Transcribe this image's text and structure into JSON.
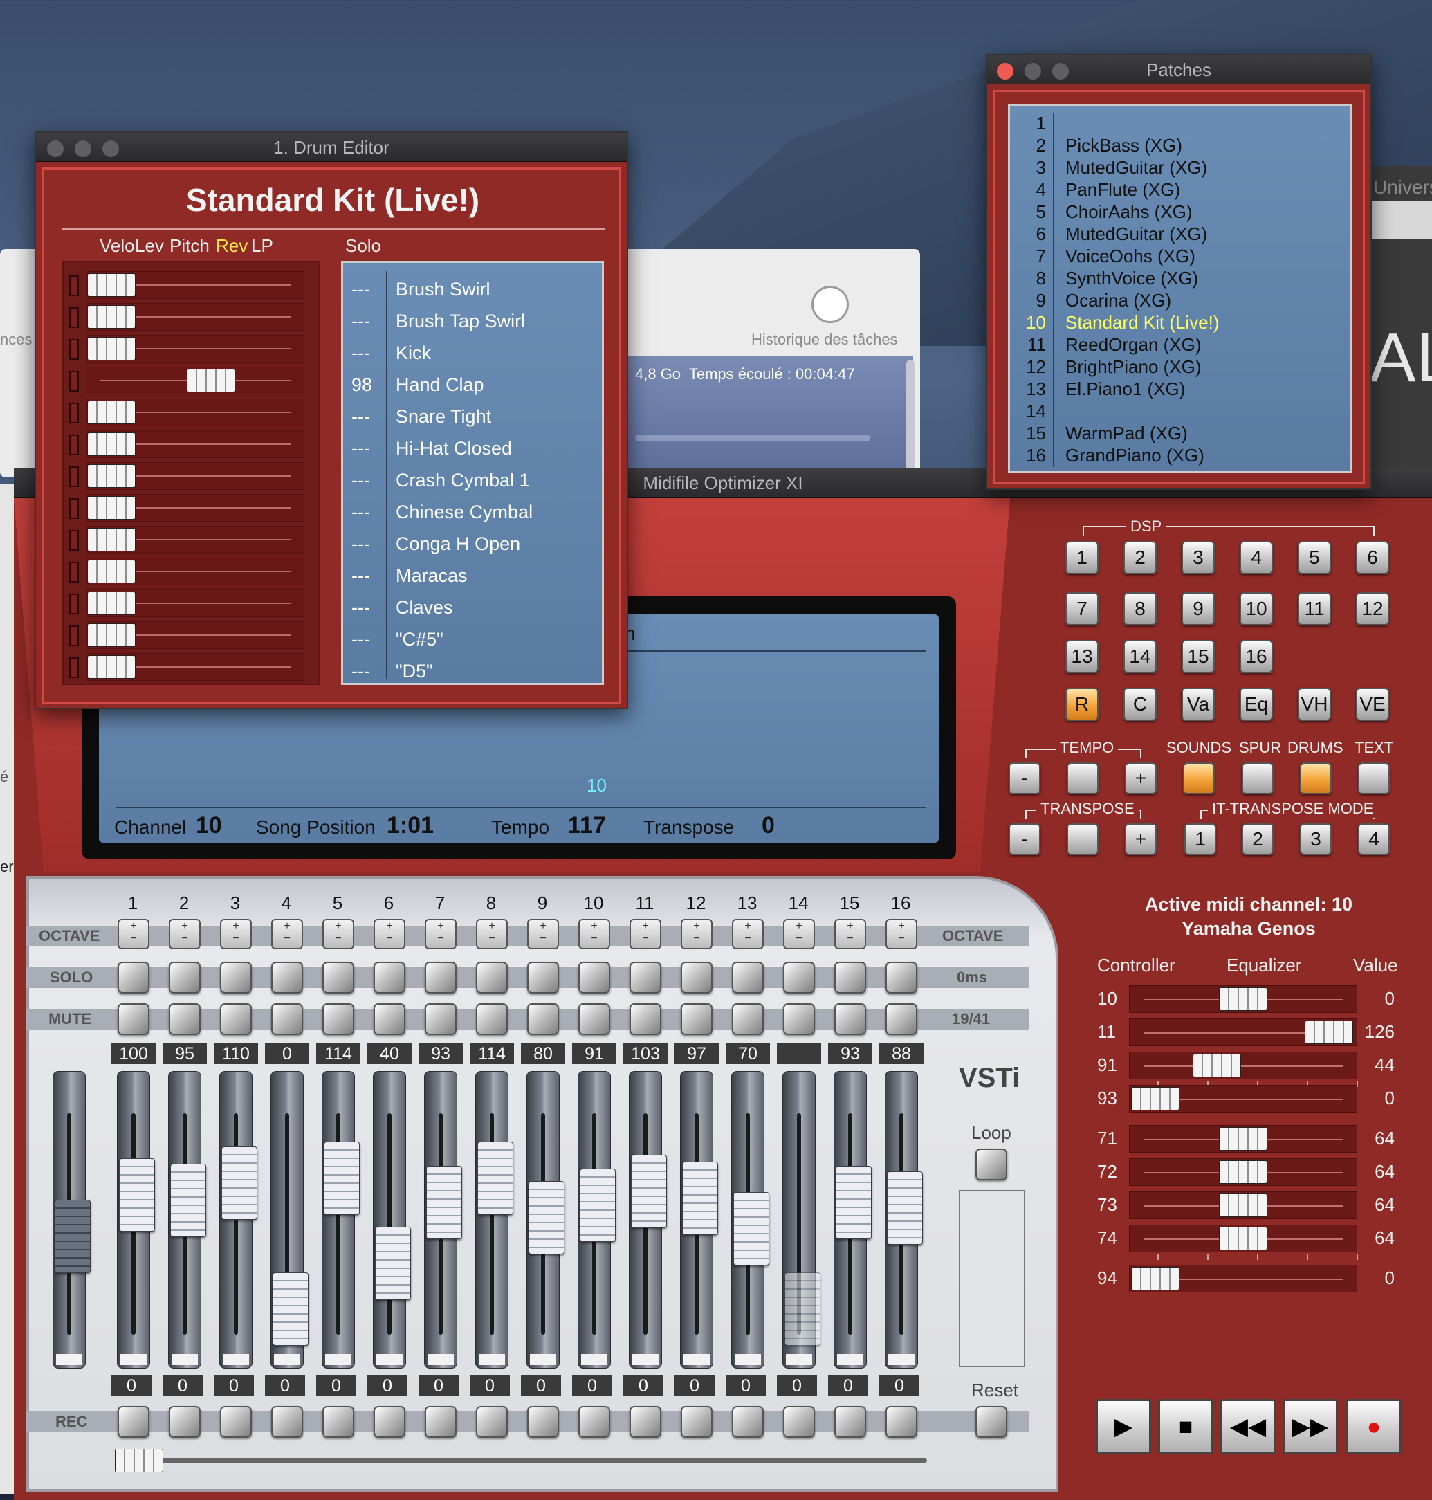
{
  "desktop": {
    "bg_window": {
      "text_left": "nces",
      "clock_label": "Historique des tâches",
      "status": "4,8 Go  Temps écoulé : 00:04:47"
    },
    "univers_text": "Univers",
    "al_text": "AL",
    "edge_char": "é",
    "edge_char2": "er"
  },
  "drum_editor": {
    "title": "1. Drum Editor",
    "kit_name": "Standard Kit (Live!)",
    "columns": [
      "Velo",
      "Lev",
      "Pitch",
      "Rev",
      "LP"
    ],
    "active_column": "Rev",
    "solo_label": "Solo",
    "rows": [
      {
        "value": "---",
        "name": "Brush Swirl",
        "slider": 0.0
      },
      {
        "value": "---",
        "name": "Brush Tap Swirl",
        "slider": 0.0
      },
      {
        "value": "---",
        "name": "Kick",
        "slider": 0.0
      },
      {
        "value": "98",
        "name": "Hand Clap",
        "slider": 0.72
      },
      {
        "value": "---",
        "name": "Snare Tight",
        "slider": 0.0
      },
      {
        "value": "---",
        "name": "Hi-Hat Closed",
        "slider": 0.0
      },
      {
        "value": "---",
        "name": "Crash Cymbal 1",
        "slider": 0.0
      },
      {
        "value": "---",
        "name": "Chinese Cymbal",
        "slider": 0.0
      },
      {
        "value": "---",
        "name": "Conga H Open",
        "slider": 0.0
      },
      {
        "value": "---",
        "name": "Maracas",
        "slider": 0.0
      },
      {
        "value": "---",
        "name": "Claves",
        "slider": 0.0
      },
      {
        "value": "---",
        "name": "\"C#5\"",
        "slider": 0.0
      },
      {
        "value": "---",
        "name": "\"D5\"",
        "slider": 0.0
      }
    ]
  },
  "patches": {
    "title": "Patches",
    "selected": "10",
    "items": [
      {
        "num": "1",
        "name": ""
      },
      {
        "num": "2",
        "name": "PickBass (XG)"
      },
      {
        "num": "3",
        "name": "MutedGuitar (XG)"
      },
      {
        "num": "4",
        "name": "PanFlute (XG)"
      },
      {
        "num": "5",
        "name": "ChoirAahs (XG)"
      },
      {
        "num": "6",
        "name": "MutedGuitar (XG)"
      },
      {
        "num": "7",
        "name": "VoiceOohs (XG)"
      },
      {
        "num": "8",
        "name": "SynthVoice (XG)"
      },
      {
        "num": "9",
        "name": "Ocarina (XG)"
      },
      {
        "num": "10",
        "name": "Standard Kit (Live!)"
      },
      {
        "num": "11",
        "name": "ReedOrgan (XG)"
      },
      {
        "num": "12",
        "name": "BrightPiano (XG)"
      },
      {
        "num": "13",
        "name": "El.Piano1 (XG)"
      },
      {
        "num": "14",
        "name": ""
      },
      {
        "num": "15",
        "name": "WarmPad (XG)"
      },
      {
        "num": "16",
        "name": "GrandPiano (XG)"
      }
    ]
  },
  "main": {
    "title": "Midifile Optimizer XI",
    "lcd": {
      "marker": "10",
      "channel_label": "Channel",
      "channel": "10",
      "songpos_label": "Song Position",
      "songpos": "1:01",
      "tempo_label": "Tempo",
      "tempo": "117",
      "transpose_label": "Transpose",
      "transpose": "0",
      "partial": "n"
    },
    "dsp_label": "DSP",
    "dsp_buttons": [
      "1",
      "2",
      "3",
      "4",
      "5",
      "6",
      "7",
      "8",
      "9",
      "10",
      "11",
      "12",
      "13",
      "14",
      "15",
      "16"
    ],
    "effect_buttons": [
      "R",
      "C",
      "Va",
      "Eq",
      "VH",
      "VE"
    ],
    "effect_active": "R",
    "tempo_label": "TEMPO",
    "sounds_label": "SOUNDS",
    "spur_label": "SPUR",
    "drums_label": "DRUMS",
    "text_label": "TEXT",
    "minus": "-",
    "plus": "+",
    "transpose_label": "TRANSPOSE",
    "ittranspose_label": "IT-TRANSPOSE MODE",
    "it_buttons": [
      "1",
      "2",
      "3",
      "4"
    ],
    "active_channel": "Active midi channel: 10",
    "device": "Yamaha Genos",
    "eq_headers": {
      "controller": "Controller",
      "equalizer": "Equalizer",
      "value": "Value"
    },
    "eq_rows": [
      {
        "ctrl": "10",
        "value": "0",
        "pos": 0.5
      },
      {
        "ctrl": "11",
        "value": "126",
        "pos": 0.99
      },
      {
        "ctrl": "91",
        "value": "44",
        "pos": 0.35
      },
      {
        "ctrl": "93",
        "value": "0",
        "pos": 0.0
      },
      {
        "ctrl": "71",
        "value": "64",
        "pos": 0.5
      },
      {
        "ctrl": "72",
        "value": "64",
        "pos": 0.5
      },
      {
        "ctrl": "73",
        "value": "64",
        "pos": 0.5
      },
      {
        "ctrl": "74",
        "value": "64",
        "pos": 0.5
      },
      {
        "ctrl": "94",
        "value": "0",
        "pos": 0.0
      }
    ],
    "mixer": {
      "octave": "OCTAVE",
      "solo": "SOLO",
      "mute": "MUTE",
      "rec": "REC",
      "solo_right": "0ms",
      "mute_right": "19/41",
      "vsti": "VSTi",
      "loop": "Loop",
      "reset": "Reset",
      "channels": [
        "1",
        "2",
        "3",
        "4",
        "5",
        "6",
        "7",
        "8",
        "9",
        "10",
        "11",
        "12",
        "13",
        "14",
        "15",
        "16"
      ],
      "volumes": [
        "100",
        "95",
        "110",
        "0",
        "114",
        "40",
        "93",
        "114",
        "80",
        "91",
        "103",
        "97",
        "70",
        "",
        "93",
        "88"
      ],
      "bottoms": [
        "0",
        "0",
        "0",
        "0",
        "0",
        "0",
        "0",
        "0",
        "0",
        "0",
        "0",
        "0",
        "0",
        "0",
        "0",
        "0"
      ],
      "master_level": 0.5
    }
  }
}
